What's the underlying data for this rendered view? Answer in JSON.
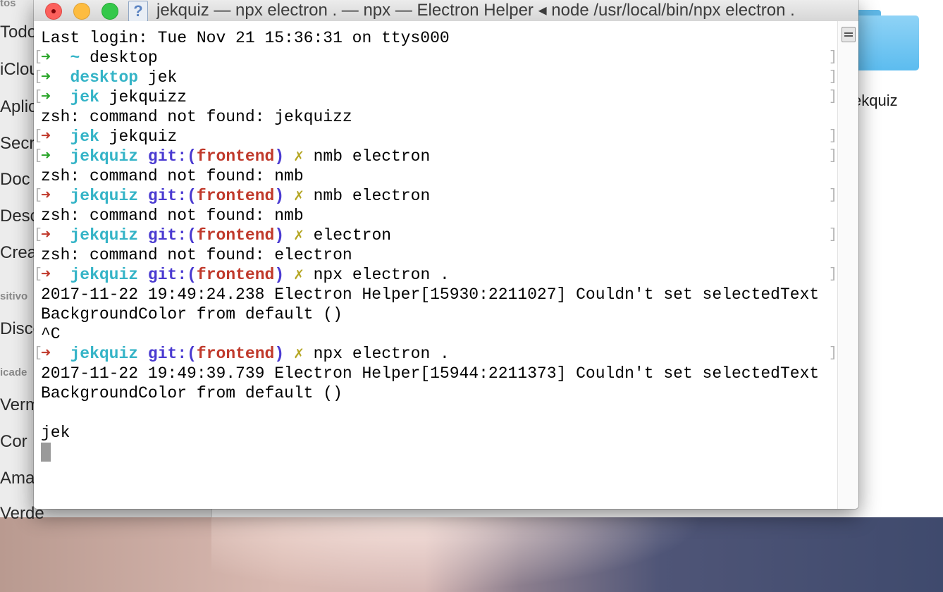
{
  "finder": {
    "sidebar": {
      "section_top": "tos",
      "items_a": [
        "Todo",
        "iClou",
        "Aplic",
        "Secr",
        "Doc",
        "Desc",
        "Crea"
      ],
      "section_devices": "sitivo",
      "device": "Disco",
      "section_tags": "icade",
      "tags": [
        "Verm",
        "Cor",
        "Ama",
        "Verde"
      ]
    },
    "folder_label": "ekquiz"
  },
  "terminal": {
    "title": "jekquiz — npx electron . — npx — Electron Helper ◂ node /usr/local/bin/npx electron .",
    "icon": "question-document-icon",
    "colors": {
      "prompt_ok": "#2aa52a",
      "prompt_err": "#c0392b",
      "dir": "#35b4c7",
      "git": "#4a3ad1",
      "branch": "#c0392b",
      "dirty": "#b5a623"
    },
    "arrow_glyph": "➜",
    "git_label": "git:(",
    "git_close": ")",
    "dirty_glyph": "✗",
    "lines": {
      "l1": "Last login: Tue Nov 21 15:36:31 on ttys000",
      "l2_dir": "~",
      "l2_cmd": " desktop",
      "l3_dir": "desktop",
      "l3_cmd": " jek",
      "l4_dir": "jek",
      "l4_cmd": " jekquizz",
      "l5": "zsh: command not found: jekquizz",
      "l6_dir": "jek",
      "l6_cmd": " jekquiz",
      "l7_dir": "jekquiz",
      "l7_branch": "frontend",
      "l7_cmd": " nmb electron",
      "l8": "zsh: command not found: nmb",
      "l9_dir": "jekquiz",
      "l9_branch": "frontend",
      "l9_cmd": " nmb electron",
      "l10": "zsh: command not found: nmb",
      "l11_dir": "jekquiz",
      "l11_branch": "frontend",
      "l11_cmd": " electron",
      "l12": "zsh: command not found: electron",
      "l13_dir": "jekquiz",
      "l13_branch": "frontend",
      "l13_cmd": " npx electron .",
      "l14": "2017-11-22 19:49:24.238 Electron Helper[15930:2211027] Couldn't set selectedText",
      "l15": "BackgroundColor from default ()",
      "l16": "^C",
      "l17_dir": "jekquiz",
      "l17_branch": "frontend",
      "l17_cmd": " npx electron .",
      "l18": "2017-11-22 19:49:39.739 Electron Helper[15944:2211373] Couldn't set selectedText",
      "l19": "BackgroundColor from default ()",
      "l20": "",
      "l21": "jek"
    }
  }
}
